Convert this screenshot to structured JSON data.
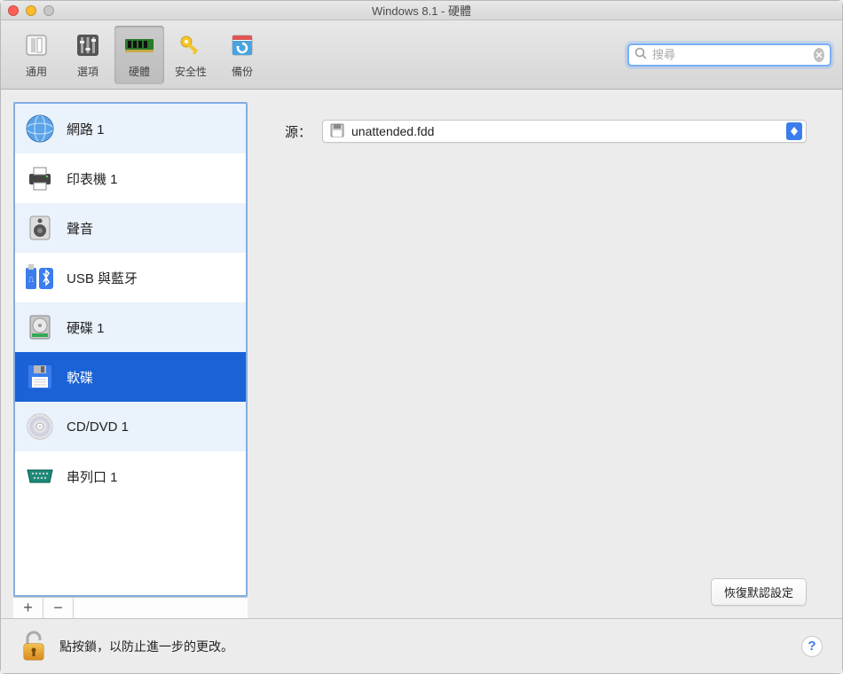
{
  "window": {
    "title": "Windows 8.1 - 硬體"
  },
  "toolbar": {
    "items": [
      {
        "label": "通用",
        "icon": "switch-icon"
      },
      {
        "label": "選項",
        "icon": "sliders-icon"
      },
      {
        "label": "硬體",
        "icon": "ram-icon",
        "selected": true
      },
      {
        "label": "安全性",
        "icon": "key-icon"
      },
      {
        "label": "備份",
        "icon": "backup-icon"
      }
    ],
    "search_placeholder": "搜尋"
  },
  "sidebar": {
    "items": [
      {
        "label": "網路 1",
        "icon": "globe-icon"
      },
      {
        "label": "印表機 1",
        "icon": "printer-icon"
      },
      {
        "label": "聲音",
        "icon": "speaker-icon"
      },
      {
        "label": "USB 與藍牙",
        "icon": "usb-bluetooth-icon"
      },
      {
        "label": "硬碟 1",
        "icon": "hdd-icon"
      },
      {
        "label": "軟碟",
        "icon": "floppy-icon",
        "selected": true
      },
      {
        "label": "CD/DVD 1",
        "icon": "cd-icon"
      },
      {
        "label": "串列口 1",
        "icon": "serial-port-icon"
      }
    ],
    "add_label": "+",
    "remove_label": "−"
  },
  "main": {
    "source_label": "源：",
    "source_value": "unattended.fdd",
    "restore_defaults_label": "恢復默認設定"
  },
  "footer": {
    "lock_text": "點按鎖，以防止進一步的更改。",
    "help_label": "?"
  }
}
